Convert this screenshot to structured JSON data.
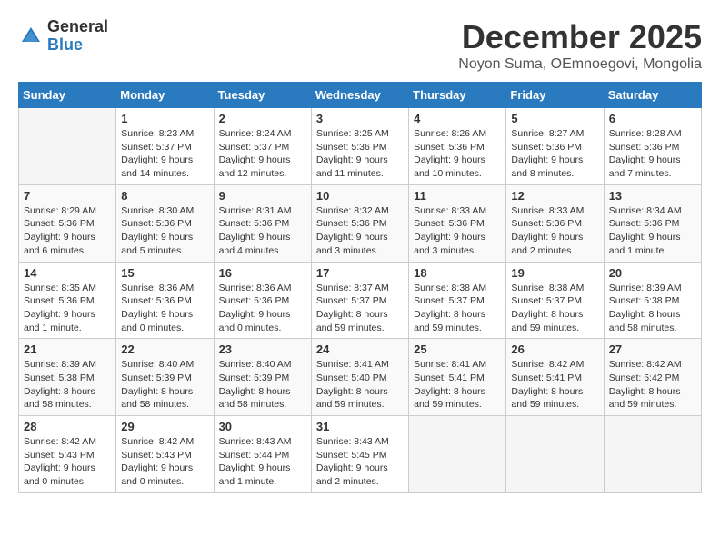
{
  "logo": {
    "general": "General",
    "blue": "Blue"
  },
  "title": "December 2025",
  "location": "Noyon Suma, OEmnoegovi, Mongolia",
  "days_of_week": [
    "Sunday",
    "Monday",
    "Tuesday",
    "Wednesday",
    "Thursday",
    "Friday",
    "Saturday"
  ],
  "weeks": [
    [
      {
        "day": "",
        "info": ""
      },
      {
        "day": "1",
        "info": "Sunrise: 8:23 AM\nSunset: 5:37 PM\nDaylight: 9 hours\nand 14 minutes."
      },
      {
        "day": "2",
        "info": "Sunrise: 8:24 AM\nSunset: 5:37 PM\nDaylight: 9 hours\nand 12 minutes."
      },
      {
        "day": "3",
        "info": "Sunrise: 8:25 AM\nSunset: 5:36 PM\nDaylight: 9 hours\nand 11 minutes."
      },
      {
        "day": "4",
        "info": "Sunrise: 8:26 AM\nSunset: 5:36 PM\nDaylight: 9 hours\nand 10 minutes."
      },
      {
        "day": "5",
        "info": "Sunrise: 8:27 AM\nSunset: 5:36 PM\nDaylight: 9 hours\nand 8 minutes."
      },
      {
        "day": "6",
        "info": "Sunrise: 8:28 AM\nSunset: 5:36 PM\nDaylight: 9 hours\nand 7 minutes."
      }
    ],
    [
      {
        "day": "7",
        "info": "Sunrise: 8:29 AM\nSunset: 5:36 PM\nDaylight: 9 hours\nand 6 minutes."
      },
      {
        "day": "8",
        "info": "Sunrise: 8:30 AM\nSunset: 5:36 PM\nDaylight: 9 hours\nand 5 minutes."
      },
      {
        "day": "9",
        "info": "Sunrise: 8:31 AM\nSunset: 5:36 PM\nDaylight: 9 hours\nand 4 minutes."
      },
      {
        "day": "10",
        "info": "Sunrise: 8:32 AM\nSunset: 5:36 PM\nDaylight: 9 hours\nand 3 minutes."
      },
      {
        "day": "11",
        "info": "Sunrise: 8:33 AM\nSunset: 5:36 PM\nDaylight: 9 hours\nand 3 minutes."
      },
      {
        "day": "12",
        "info": "Sunrise: 8:33 AM\nSunset: 5:36 PM\nDaylight: 9 hours\nand 2 minutes."
      },
      {
        "day": "13",
        "info": "Sunrise: 8:34 AM\nSunset: 5:36 PM\nDaylight: 9 hours\nand 1 minute."
      }
    ],
    [
      {
        "day": "14",
        "info": "Sunrise: 8:35 AM\nSunset: 5:36 PM\nDaylight: 9 hours\nand 1 minute."
      },
      {
        "day": "15",
        "info": "Sunrise: 8:36 AM\nSunset: 5:36 PM\nDaylight: 9 hours\nand 0 minutes."
      },
      {
        "day": "16",
        "info": "Sunrise: 8:36 AM\nSunset: 5:36 PM\nDaylight: 9 hours\nand 0 minutes."
      },
      {
        "day": "17",
        "info": "Sunrise: 8:37 AM\nSunset: 5:37 PM\nDaylight: 8 hours\nand 59 minutes."
      },
      {
        "day": "18",
        "info": "Sunrise: 8:38 AM\nSunset: 5:37 PM\nDaylight: 8 hours\nand 59 minutes."
      },
      {
        "day": "19",
        "info": "Sunrise: 8:38 AM\nSunset: 5:37 PM\nDaylight: 8 hours\nand 59 minutes."
      },
      {
        "day": "20",
        "info": "Sunrise: 8:39 AM\nSunset: 5:38 PM\nDaylight: 8 hours\nand 58 minutes."
      }
    ],
    [
      {
        "day": "21",
        "info": "Sunrise: 8:39 AM\nSunset: 5:38 PM\nDaylight: 8 hours\nand 58 minutes."
      },
      {
        "day": "22",
        "info": "Sunrise: 8:40 AM\nSunset: 5:39 PM\nDaylight: 8 hours\nand 58 minutes."
      },
      {
        "day": "23",
        "info": "Sunrise: 8:40 AM\nSunset: 5:39 PM\nDaylight: 8 hours\nand 58 minutes."
      },
      {
        "day": "24",
        "info": "Sunrise: 8:41 AM\nSunset: 5:40 PM\nDaylight: 8 hours\nand 59 minutes."
      },
      {
        "day": "25",
        "info": "Sunrise: 8:41 AM\nSunset: 5:41 PM\nDaylight: 8 hours\nand 59 minutes."
      },
      {
        "day": "26",
        "info": "Sunrise: 8:42 AM\nSunset: 5:41 PM\nDaylight: 8 hours\nand 59 minutes."
      },
      {
        "day": "27",
        "info": "Sunrise: 8:42 AM\nSunset: 5:42 PM\nDaylight: 8 hours\nand 59 minutes."
      }
    ],
    [
      {
        "day": "28",
        "info": "Sunrise: 8:42 AM\nSunset: 5:43 PM\nDaylight: 9 hours\nand 0 minutes."
      },
      {
        "day": "29",
        "info": "Sunrise: 8:42 AM\nSunset: 5:43 PM\nDaylight: 9 hours\nand 0 minutes."
      },
      {
        "day": "30",
        "info": "Sunrise: 8:43 AM\nSunset: 5:44 PM\nDaylight: 9 hours\nand 1 minute."
      },
      {
        "day": "31",
        "info": "Sunrise: 8:43 AM\nSunset: 5:45 PM\nDaylight: 9 hours\nand 2 minutes."
      },
      {
        "day": "",
        "info": ""
      },
      {
        "day": "",
        "info": ""
      },
      {
        "day": "",
        "info": ""
      }
    ]
  ]
}
